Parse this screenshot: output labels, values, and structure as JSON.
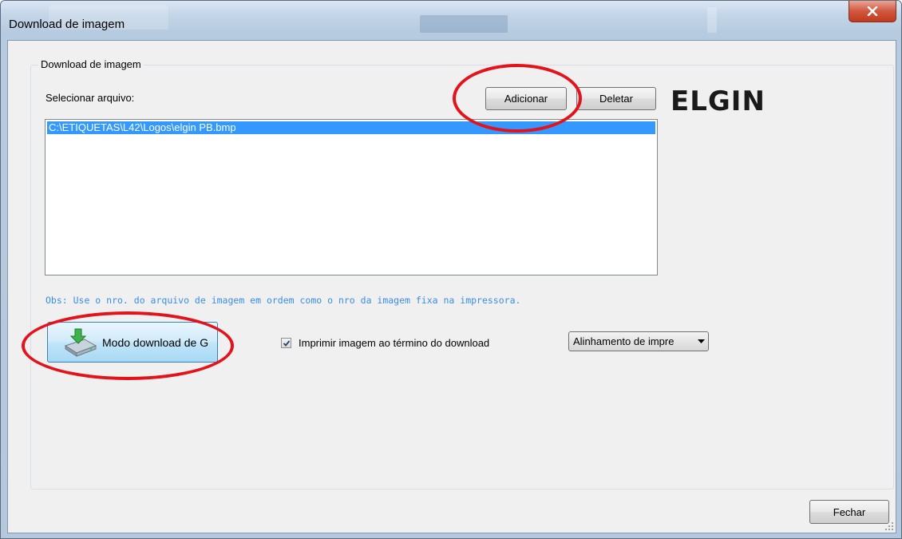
{
  "window": {
    "title": "Download de imagem",
    "close_glyph": "x"
  },
  "group": {
    "legend": "Download de imagem",
    "select_label": "Selecionar arquivo:",
    "add_button": "Adicionar",
    "delete_button": "Deletar",
    "logo": "ELGIN",
    "files": [
      "C:\\ETIQUETAS\\L42\\Logos\\elgin PB.bmp"
    ],
    "note": "Obs: Use o nro. do arquivo de imagem em ordem como o nro da imagem fixa na impressora.",
    "mode_button": "Modo download de G",
    "print_checkbox_label": "Imprimir imagem ao término do download",
    "print_checkbox_checked": true,
    "alignment_select": "Alinhamento de impre"
  },
  "footer": {
    "close_button": "Fechar"
  },
  "colors": {
    "highlight_ring": "#e4121b",
    "selection": "#3399ff",
    "note_text": "#3b8ee6"
  },
  "icons": {
    "close": "close-x-icon",
    "mode_button": "download-drive-icon",
    "check": "checkmark-icon",
    "dropdown": "dropdown-arrow-icon",
    "grip": "resize-grip-icon"
  }
}
